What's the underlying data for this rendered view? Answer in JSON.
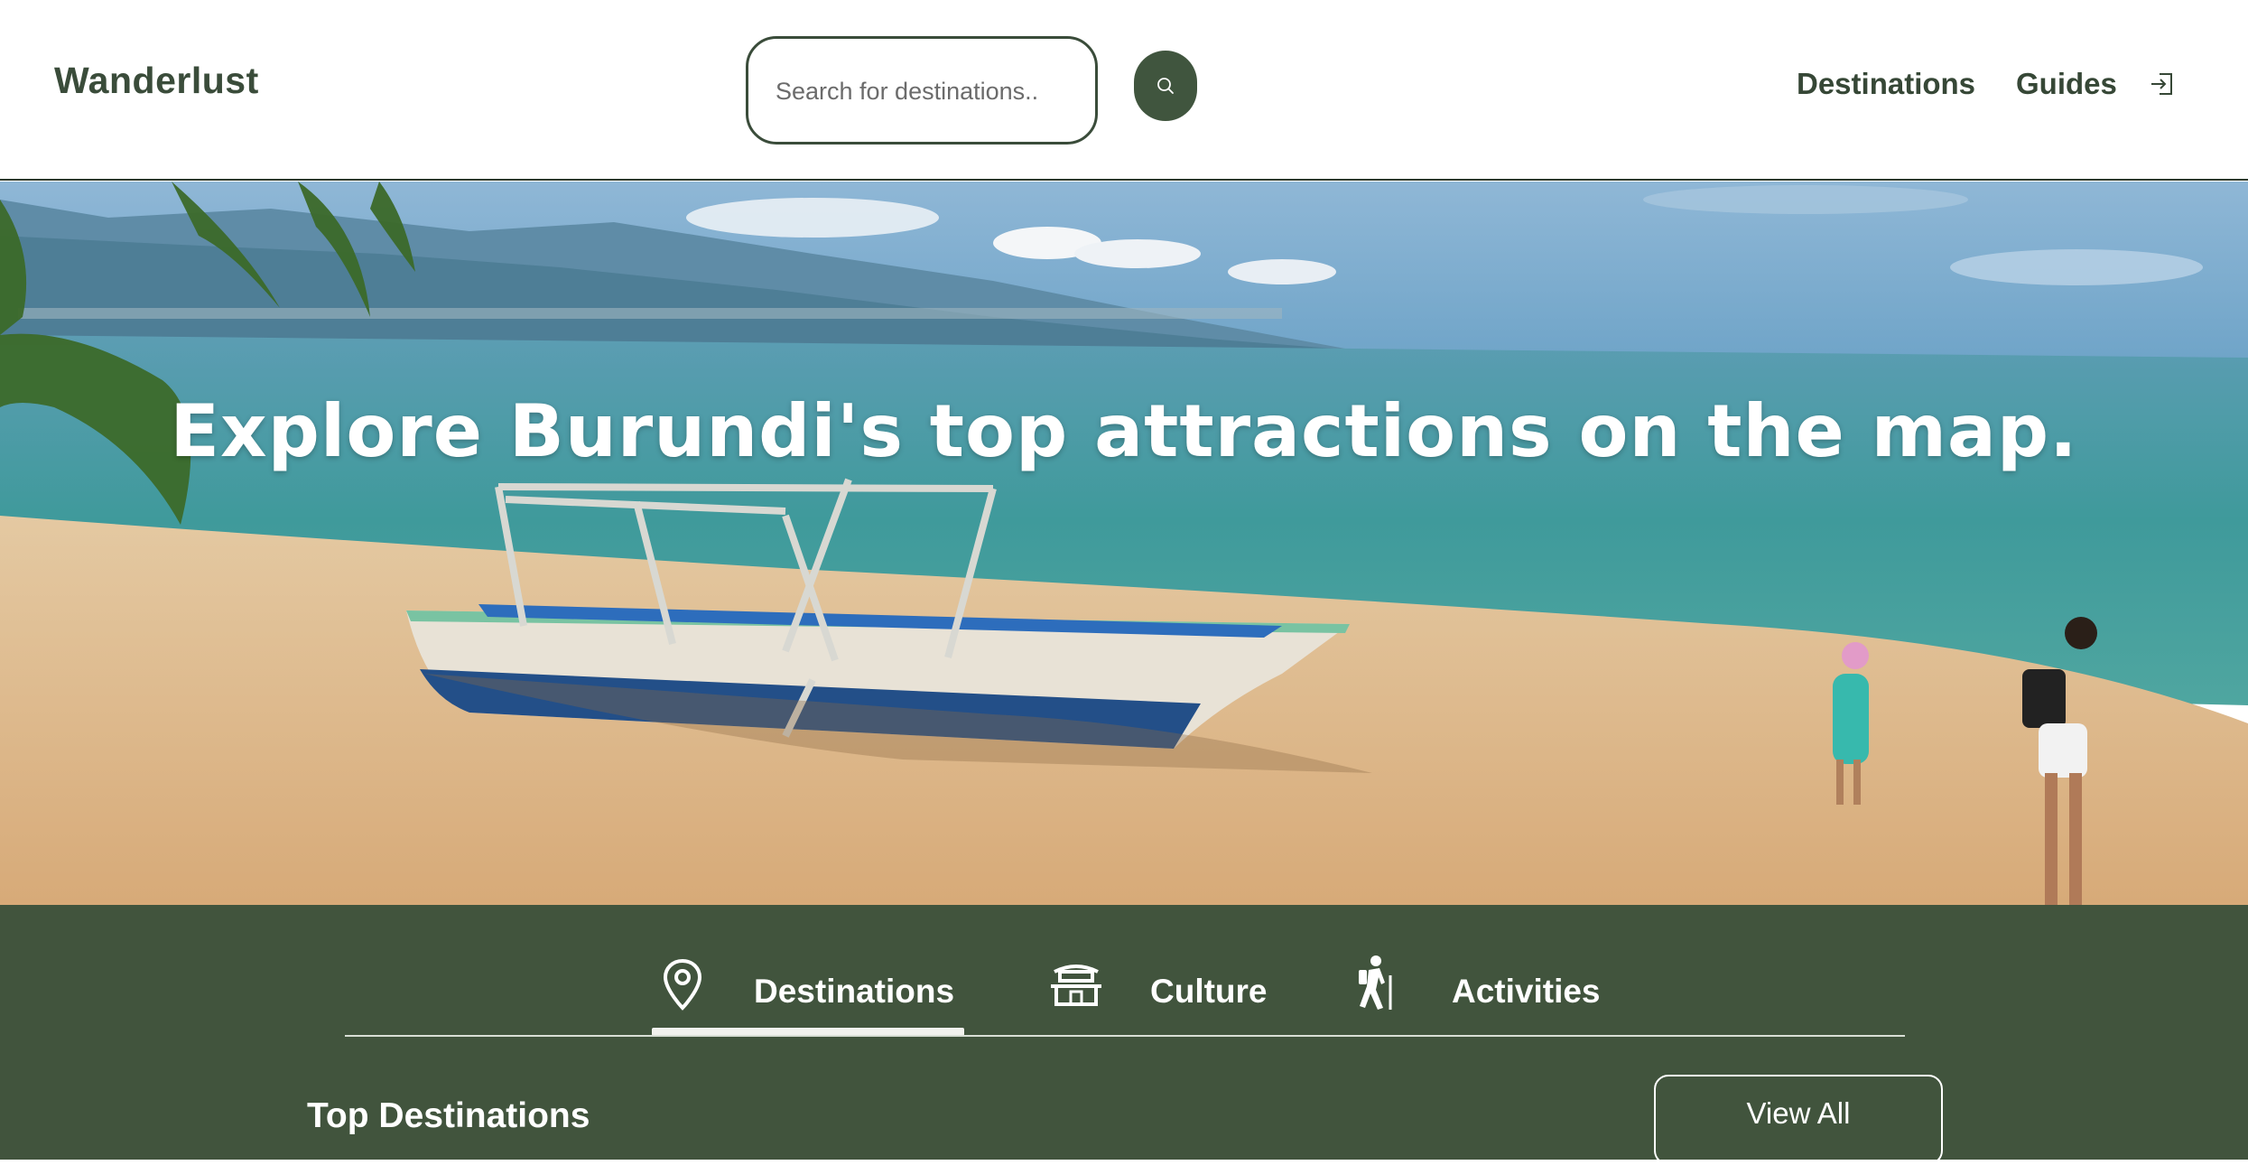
{
  "header": {
    "logo": "Wanderlust",
    "search": {
      "placeholder": "Search for destinations..",
      "value": ""
    },
    "nav": {
      "destinations": "Destinations",
      "guides": "Guides"
    },
    "icons": {
      "search": "search-icon",
      "login": "login-icon"
    }
  },
  "hero": {
    "title": "Explore Burundi's top attractions on the map."
  },
  "tabs": [
    {
      "label": "Destinations",
      "icon": "map-pin-icon",
      "active": true
    },
    {
      "label": "Culture",
      "icon": "pagoda-icon",
      "active": false
    },
    {
      "label": "Activities",
      "icon": "hiker-icon",
      "active": false
    }
  ],
  "section": {
    "title": "Top Destinations",
    "view_all": "View All"
  },
  "colors": {
    "brand_green": "#41543d",
    "text_dark": "#364736"
  }
}
